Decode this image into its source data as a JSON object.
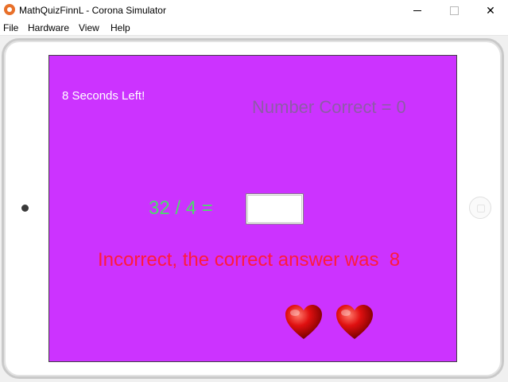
{
  "window": {
    "title": "MathQuizFinnL - Corona Simulator",
    "minimize_glyph": "",
    "close_glyph": "✕"
  },
  "menu": {
    "items": [
      {
        "label": "File"
      },
      {
        "label": "Hardware"
      },
      {
        "label": "View"
      },
      {
        "label": "Help"
      }
    ]
  },
  "game": {
    "timer_text": "8 Seconds Left!",
    "score_text": "Number Correct = 0",
    "question_text": "32 / 4 =",
    "answer_value": "",
    "feedback_text": "Incorrect, the correct answer was  8",
    "lives_remaining": 2
  },
  "colors": {
    "screen_background": "#cc33ff",
    "timer": "#ffffff",
    "score": "#8e5aa8",
    "question": "#4ddb6b",
    "feedback": "#ff1a3c",
    "heart": "#d40000"
  }
}
